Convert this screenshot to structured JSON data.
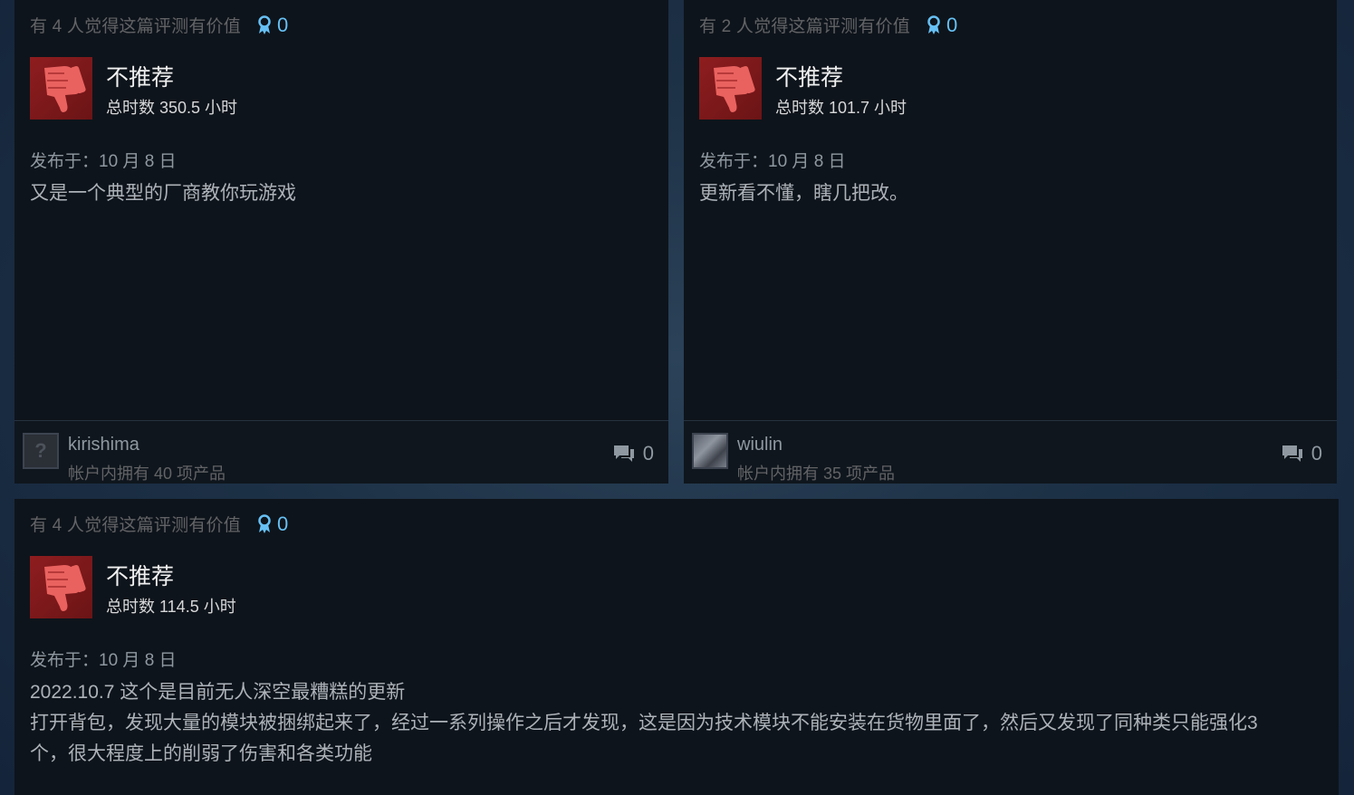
{
  "reviews": [
    {
      "helpful": "有 4 人觉得这篇评测有价值",
      "awards": "0",
      "verdict": "不推荐",
      "hours": "总时数 350.5 小时",
      "posted": "发布于：10 月 8 日",
      "body": "又是一个典型的厂商教你玩游戏",
      "username": "kirishima",
      "owned": "帐户内拥有 40 项产品",
      "comments": "0",
      "avatar": "?"
    },
    {
      "helpful": "有 2 人觉得这篇评测有价值",
      "awards": "0",
      "verdict": "不推荐",
      "hours": "总时数 101.7 小时",
      "posted": "发布于：10 月 8 日",
      "body": "更新看不懂，瞎几把改。",
      "username": "wiulin",
      "owned": "帐户内拥有 35 项产品",
      "comments": "0"
    },
    {
      "helpful": "有 4 人觉得这篇评测有价值",
      "awards": "0",
      "verdict": "不推荐",
      "hours": "总时数 114.5 小时",
      "posted": "发布于：10 月 8 日",
      "body_lines": [
        "2022.10.7 这个是目前无人深空最糟糕的更新",
        "打开背包，发现大量的模块被捆绑起来了，经过一系列操作之后才发现，这是因为技术模块不能安装在货物里面了，然后又发现了同种类只能强化3",
        "个，很大程度上的削弱了伤害和各类功能"
      ]
    }
  ],
  "colors": {
    "card_bg": "#0e141b",
    "award_blue": "#66c0f4",
    "thumb_red": "#8e1d1f"
  },
  "icons": {
    "award": "award-ribbon-icon",
    "thumb": "thumbs-down-icon",
    "comment": "comment-bubbles-icon"
  }
}
